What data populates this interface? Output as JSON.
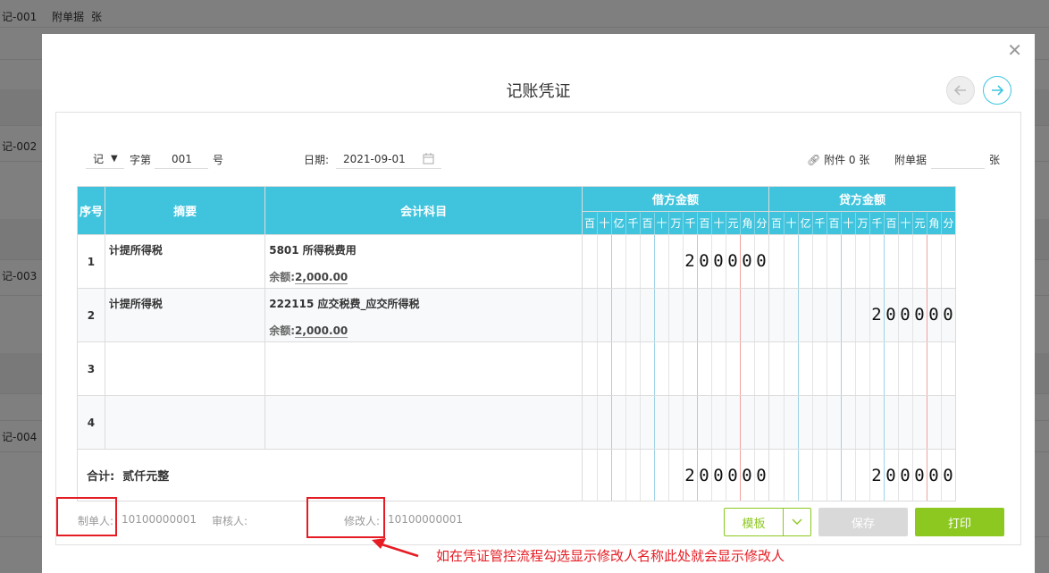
{
  "background": {
    "rows": [
      {
        "label": "记-001",
        "attach_label": "附单据",
        "attach_unit": "张"
      },
      {
        "label": "记-002"
      },
      {
        "label": "记-003"
      },
      {
        "label": "记-004"
      }
    ]
  },
  "modal": {
    "title": "记账凭证",
    "voucher_type": "记",
    "zi_label": "字第",
    "number": "001",
    "hao_label": "号",
    "date_label": "日期:",
    "date_value": "2021-09-01",
    "attachment_label": "附件 0 张",
    "attach_doc_label": "附单据",
    "attach_doc_value": "",
    "attach_doc_unit": "张"
  },
  "table": {
    "headers": {
      "seq": "序号",
      "summary": "摘要",
      "subject": "会计科目",
      "debit": "借方金额",
      "credit": "贷方金额"
    },
    "digit_units": [
      "百",
      "十",
      "亿",
      "千",
      "百",
      "十",
      "万",
      "千",
      "百",
      "十",
      "元",
      "角",
      "分"
    ],
    "rows": [
      {
        "seq": "1",
        "summary": "计提所得税",
        "subject": "5801 所得税费用",
        "balance_label": "余额:",
        "balance": "2,000.00",
        "debit": "200000",
        "credit": ""
      },
      {
        "seq": "2",
        "summary": "计提所得税",
        "subject": "222115 应交税费_应交所得税",
        "balance_label": "余额:",
        "balance": "2,000.00",
        "debit": "",
        "credit": "200000"
      },
      {
        "seq": "3",
        "summary": "",
        "subject": "",
        "balance_label": "",
        "balance": "",
        "debit": "",
        "credit": ""
      },
      {
        "seq": "4",
        "summary": "",
        "subject": "",
        "balance_label": "",
        "balance": "",
        "debit": "",
        "credit": ""
      }
    ],
    "total_label": "合计:",
    "total_words": "贰仟元整",
    "total_debit": "200000",
    "total_credit": "200000"
  },
  "footer": {
    "maker_label": "制单人:",
    "maker_value": "10100000001",
    "reviewer_label": "审核人:",
    "reviewer_value": "",
    "modifier_label": "修改人:",
    "modifier_value": "10100000001",
    "template_label": "模板",
    "save_label": "保存",
    "print_label": "打印"
  },
  "annotation": "如在凭证管控流程勾选显示修改人名称此处就会显示修改人",
  "colors": {
    "header_bg": "#40c4dd",
    "primary_green": "#8cc820",
    "annotation_red": "#e51c23"
  }
}
